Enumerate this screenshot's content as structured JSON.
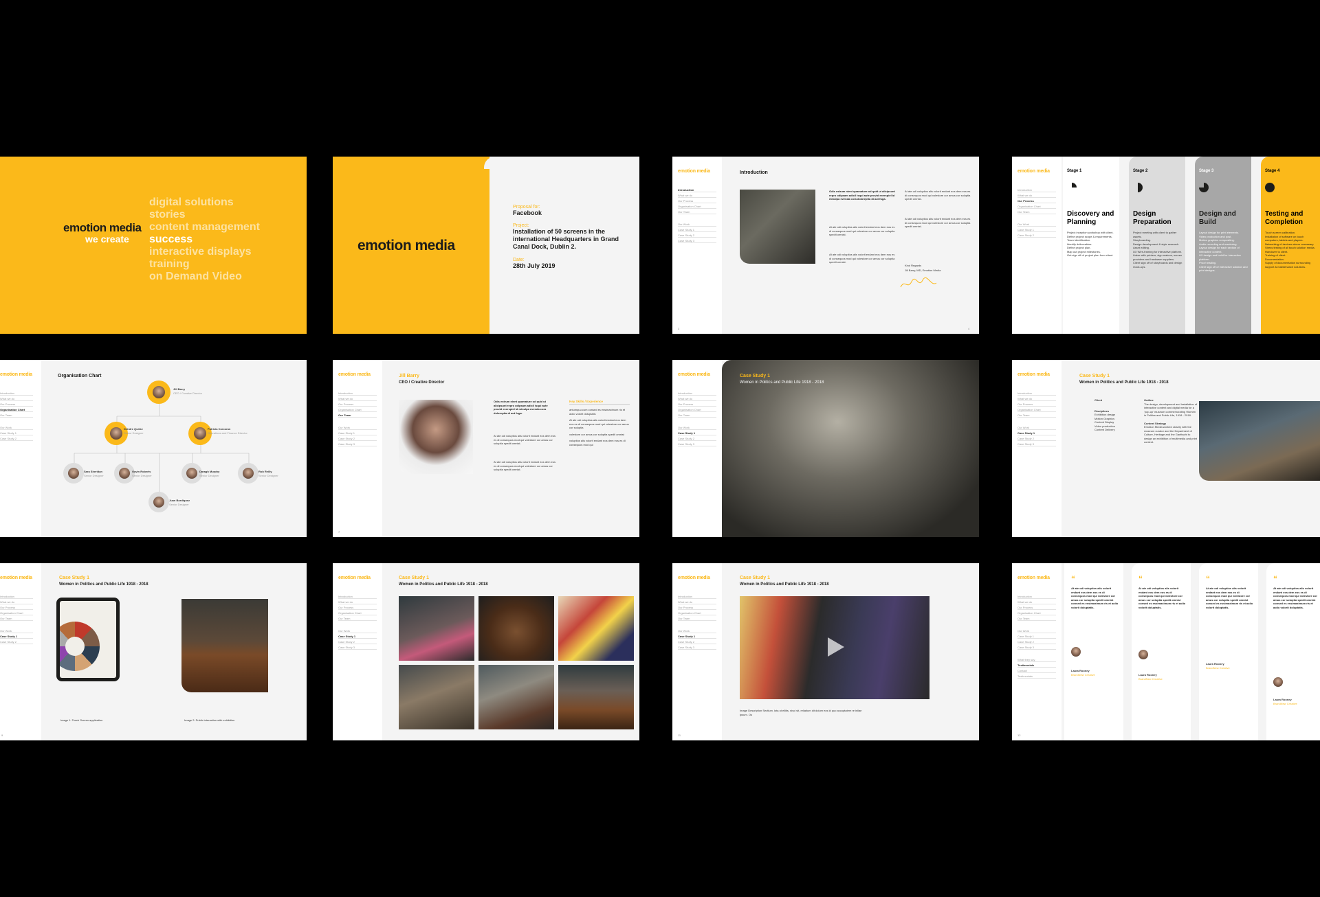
{
  "brand": {
    "logo": "emotion media",
    "yellow": "#fbb91a",
    "dark": "#1d1d1b"
  },
  "nav": [
    "Introduction",
    "What we do",
    "Our Process",
    "Organisation Chart",
    "Our Team",
    "Our Work",
    "Case Study 1",
    "Case Study 2",
    "Case Study 3",
    "What they say",
    "Testimonials",
    "Contact",
    "Testimonials"
  ],
  "slide1": {
    "we_create": "we create",
    "words": [
      "digital solutions",
      "stories",
      "content management",
      "success",
      "interactive displays",
      "training",
      "on Demand Video"
    ]
  },
  "slide2": {
    "proposal_for_label": "Proposal for:",
    "proposal_for": "Facebook",
    "project_label": "Project:",
    "project": "Installation of 50 screens in the international Headquarters in Grand Canal Dock, Dublin 2.",
    "date_label": "Date:",
    "date": "28th July 2019"
  },
  "slide3": {
    "title": "Introduction",
    "bold_intro": "Odis estrum nient quamature od quid ut alicipsunt repro odipsam adicil isqui aute provid exerspiel id minulpa evenda cora doloreptia di aut fuga.",
    "para": "At ate odi voluptios alis volorit endant eos dem eos es di consequos mod qui volestore cor amus cor soluptia spedit omnist.",
    "signoff": "Kind Regards",
    "signer": "Jill Barry, MD, Emotion Media",
    "page_l": "3",
    "page_r": "4"
  },
  "slide4": {
    "stages": [
      {
        "label": "Stage 1",
        "title": "Discovery and Planning",
        "items": [
          "Project inception workshop with client.",
          "Define project scope & requirements.",
          "Team identification.",
          "Identify deliverables.",
          "Define project plan.",
          "Map out project milestones.",
          "Get sign off of project plan from client."
        ]
      },
      {
        "label": "Stage 2",
        "title": "Design Preparation",
        "items": [
          "Project meeting with client to gather assets.",
          "Storyboarding.",
          "Design development & style research.",
          "Asset editing.",
          "UX Wire-framing for interactive platform.",
          "Liaise with printers, sign makers, screen providers and hardware suppliers.",
          "Client sign off of storyboards and design mock-ups."
        ]
      },
      {
        "label": "Stage 3",
        "title": "Design and Build",
        "items": [
          "Layout design for print elements.",
          "Video production and post.",
          "Motion graphics compositing.",
          "Audio recording and mastering.",
          "Layout design for each section of interactive content.",
          "UX design and build for interactive platform.",
          "Proof reading.",
          "Client sign off of interactive solution and print designs."
        ]
      },
      {
        "label": "Stage 4",
        "title": "Testing and Completion",
        "items": [
          "Touch screen calibration.",
          "Installation of software on touch computers, tablets and players.",
          "Networking of devices where necessary.",
          "Stress testing of all touch solution media.",
          "Handover to client.",
          "Training of client.",
          "Documentation.",
          "Supply of documentation surrounding support & maintenance solutions."
        ]
      }
    ]
  },
  "slide5": {
    "title": "Organisation Chart",
    "people": [
      {
        "name": "Jill Barry",
        "role": "CEO / Creative Director"
      },
      {
        "name": "Deirdre Quirke",
        "role": "Senior Designer"
      },
      {
        "name": "Patricia Corcoran",
        "role": "Operations and Finance Director"
      },
      {
        "name": "Sara Sheridan",
        "role": "Senior Designer"
      },
      {
        "name": "Gavin Roberts",
        "role": "Senior Designer"
      },
      {
        "name": "Daragh Murphy",
        "role": "Senior Designer"
      },
      {
        "name": "Rob Reilly",
        "role": "Senior Designer"
      },
      {
        "name": "Juan Bordiquez",
        "role": "Senior Designer"
      }
    ]
  },
  "slide6": {
    "name": "Jill Barry",
    "role": "CEO / Creative Director",
    "skills_title": "Key Skills / Experience",
    "para_bold": "Odis estrum nient quamature od quid ut alicipsunt repro odipsam adicil isqui aute provid exerspiel id minulpa evenda cora doloreptia di aut fuga.",
    "para": "At ate odi voluptios alis volorit endant eos dem eos es di consequos mod qui volestore cor amus cor soluptia spedit omnist.",
    "skills": [
      "antumquu cum consed es essimaximum ris et aolio volorit doluptatis",
      "At ate odi voluptios alis volorit endant eos dem eos es di consequos mod qui volestore cor amus cor soluptia",
      "volestore cor amus cor soluptia spedit omnist",
      "voluptios alis volorit endant eos dem eos es di consequos mod qui"
    ],
    "page": "7"
  },
  "case": {
    "label": "Case Study 1",
    "title": "Women in Politics and Public Life 1918 - 2018"
  },
  "slide8": {
    "client_label": "Client",
    "outline_label": "Outline",
    "outline": "The design, development and installation of interactive content and digital media for a 'pop-up' museum commemorating Women in Politics and Public Life, 1918 - 2018.",
    "disciplines_label": "Disciplines",
    "disciplines": [
      "Exhibition design",
      "Motion Graphics",
      "Content Display",
      "Video production",
      "Content Delivery"
    ],
    "context_label": "Context Strategy",
    "context": "Emotion Media worked closely with the museum curator and the Department of Culture, Heritage and the Gaeltacht to design an exhibition of multimedia and print content."
  },
  "slide9": {
    "cap1": "Image 1: Touch Screen application",
    "cap2": "Image 2: Public interaction with exhibition",
    "page": "9"
  },
  "slide11": {
    "caption": "Image Description Sectium. Ista ut ellitis, nisci sit, reliatium dit dolum eos id quo accuptatem re inllae ipsum. Os",
    "page": "11"
  },
  "slide12": {
    "quote": "At ate odi voluptios alis volorit endant eos dem eos es di consequos mod qui volestore cor amus cor soluptia spedit omnist consed es essimaximum ris et aolio volorit doluptatis.",
    "name": "Laura Rooney",
    "company": "BrandNew Creative",
    "page": "12"
  }
}
